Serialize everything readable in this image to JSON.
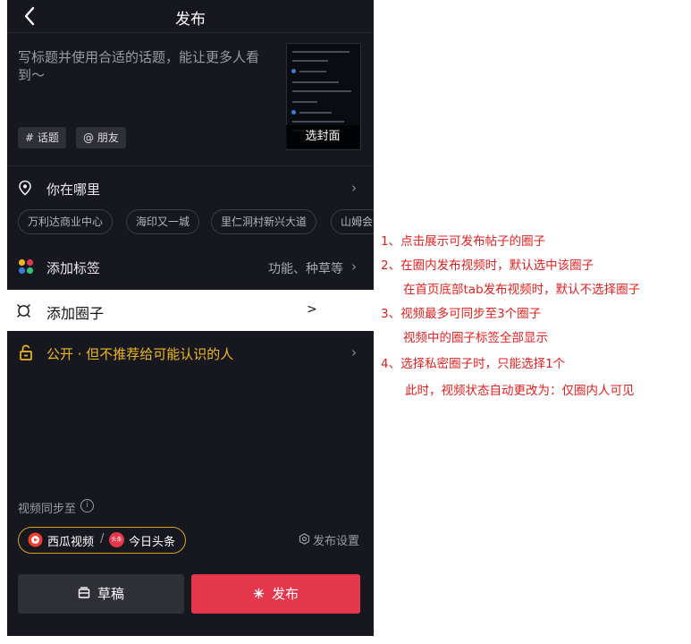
{
  "header": {
    "title": "发布"
  },
  "editor": {
    "placeholder": "写标题并使用合适的话题，能让更多人看到～",
    "topic_chip": "# 话题",
    "friend_chip": "@ 朋友",
    "cover_label": "选封面"
  },
  "location": {
    "label": "你在哪里",
    "suggestions": [
      "万利达商业中心",
      "海印又一城",
      "里仁洞村新兴大道",
      "山姆会"
    ]
  },
  "tags": {
    "label": "添加标签",
    "value": "功能、种草等"
  },
  "circle": {
    "label": "添加圈子",
    "arrow": ">"
  },
  "privacy": {
    "label": "公开 · 但不推荐给可能认识的人"
  },
  "sync": {
    "label": "视频同步至",
    "xigua": "西瓜视频",
    "separator": "/",
    "toutiao": "今日头条",
    "toutiao_badge": "头条",
    "settings": "发布设置"
  },
  "actions": {
    "draft": "草稿",
    "publish": "发布"
  },
  "colors": {
    "background": "#16171f",
    "publish": "#e5374c",
    "draft": "#2e2f37",
    "privacy": "#f0b820",
    "annotation": "#e02020"
  },
  "annotations": [
    "1、点击展示可发布帖子的圈子",
    "2、在圈内发布视频时，默认选中该圈子",
    "在首页底部tab发布视频时，默认不选择圈子",
    "3、视频最多可同步至3个圈子",
    "视频中的圈子标签全部显示",
    "4、选择私密圈子时，只能选择1个",
    "此时，视频状态自动更改为：仅圈内人可见"
  ]
}
